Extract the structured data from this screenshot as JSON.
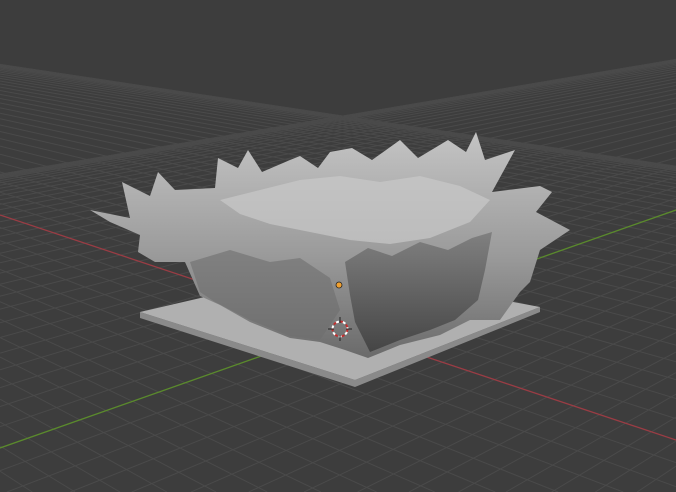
{
  "viewport": {
    "background_color": "#3d3d3d",
    "grid_color": "#4a4a4a",
    "x_axis_color": "#9a3c44",
    "y_axis_color": "#5a8a2c",
    "model_color": "#a9a9a9",
    "model_shadow_color": "#5e5e5e",
    "origin_color": "#f0a030",
    "cursor_icon": "3d-cursor-icon",
    "origin_icon": "object-origin-icon"
  }
}
